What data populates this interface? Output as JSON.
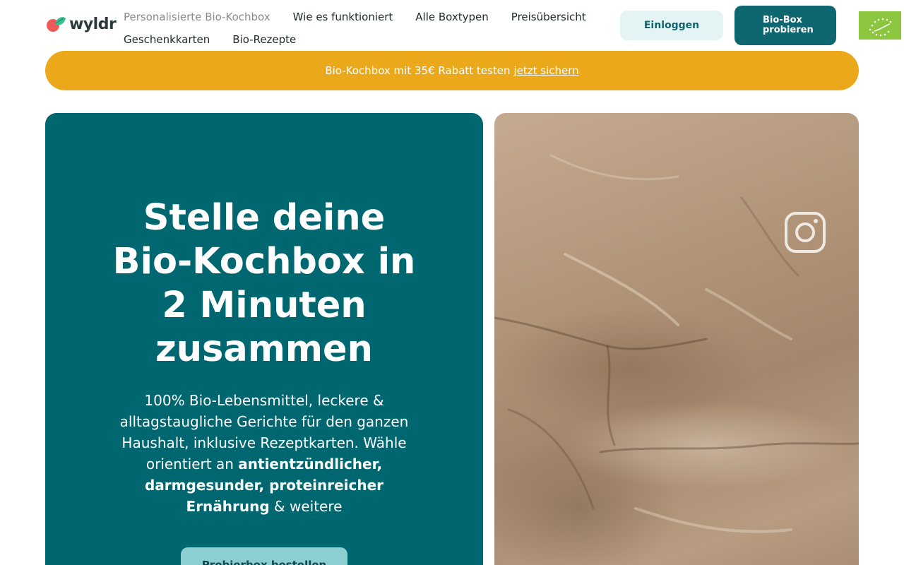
{
  "header": {
    "logo_text": "wyldr",
    "nav_row1": [
      "Personalisierte Bio-Kochbox",
      "Wie es funktioniert",
      "Alle Boxtypen",
      "Preisübersicht"
    ],
    "nav_row2": [
      "Geschenkkarten",
      "Bio-Rezepte"
    ],
    "login_label": "Einloggen",
    "try_label_line1": "Bio-Box",
    "try_label_line2": "probieren"
  },
  "promo": {
    "text": "Bio-Kochbox mit 35€ Rabatt testen",
    "link": "jetzt sichern"
  },
  "hero": {
    "title": "Stelle deine Bio-Kochbox in 2 Minuten zusammen",
    "desc_plain": "100% Bio-Lebensmittel, leckere & alltagstaugliche Gerichte für den ganzen Haushalt, inklusive Rezeptkarten. Wähle orientiert an",
    "desc_bold": "antientzündlicher, darmgesunder, proteinreicher Ernährung",
    "desc_tail": "& weitere",
    "cta_label": "Probierbox bestellen"
  },
  "media": {
    "icon": "instagram-icon"
  },
  "colors": {
    "brand_teal": "#006771",
    "promo_yellow": "#eaa81a",
    "login_bg": "#e4f4f4",
    "cta_light": "#8ccfd0",
    "eu_green": "#8cc63f"
  }
}
